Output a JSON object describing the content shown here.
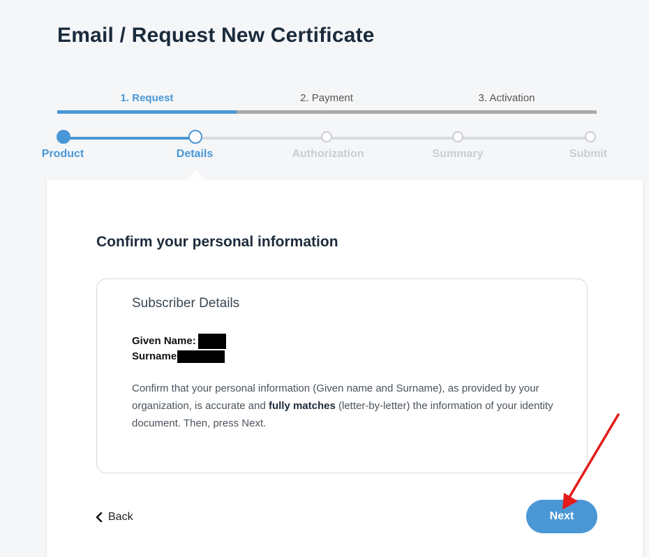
{
  "page": {
    "title": "Email / Request New Certificate"
  },
  "tabs": [
    {
      "label": "1. Request",
      "active": true
    },
    {
      "label": "2. Payment",
      "active": false
    },
    {
      "label": "3. Activation",
      "active": false
    }
  ],
  "steps": [
    {
      "label": "Product",
      "state": "done"
    },
    {
      "label": "Details",
      "state": "current"
    },
    {
      "label": "Authorization",
      "state": "todo"
    },
    {
      "label": "Summary",
      "state": "todo"
    },
    {
      "label": "Submit",
      "state": "todo"
    }
  ],
  "card": {
    "title": "Confirm your personal information",
    "box_title": "Subscriber Details",
    "given_name_label": "Given Name:",
    "surname_label": "Surname",
    "note_part1": "Confirm that your personal information (Given name and Surname), as provided by your organization, is accurate and ",
    "note_bold": "fully matches",
    "note_part2": " (letter-by-letter) the information of your identity document. Then, press Next."
  },
  "actions": {
    "back_label": "Back",
    "next_label": "Next"
  },
  "colors": {
    "accent": "#4a97d6",
    "annotation_arrow": "#e31b1b"
  }
}
